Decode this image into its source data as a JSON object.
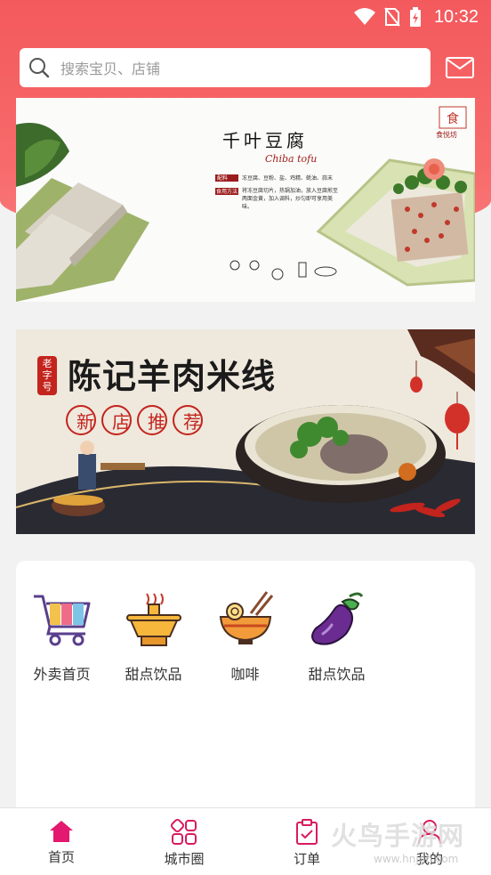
{
  "status_bar": {
    "time": "10:32"
  },
  "search": {
    "placeholder": "搜索宝贝、店铺"
  },
  "banner1": {
    "title": "千叶豆腐",
    "subtitle": "Chiba tofu",
    "tag1": "配料",
    "desc1": "冻豆腐、豆粉、盐、鸡精、蚝油、蒜末",
    "tag2": "食用方法",
    "desc2": "将冻豆腐切片，热锅加油，放入豆腐煎至两面金黄，加入调料，炒匀即可享用美味。",
    "brand": "食悦坊"
  },
  "banner2": {
    "badge": "老字号",
    "title": "陈记羊肉米线",
    "chars": [
      "新",
      "店",
      "推",
      "荐"
    ]
  },
  "categories": [
    {
      "label": "外卖首页",
      "icon": "shopping-cart-icon"
    },
    {
      "label": "甜点饮品",
      "icon": "hotpot-icon"
    },
    {
      "label": "咖啡",
      "icon": "noodle-bowl-icon"
    },
    {
      "label": "甜点饮品",
      "icon": "eggplant-icon"
    }
  ],
  "tabs": [
    {
      "label": "首页",
      "icon": "home-icon",
      "active": true
    },
    {
      "label": "城市圈",
      "icon": "grid-icon"
    },
    {
      "label": "订单",
      "icon": "order-icon"
    },
    {
      "label": "我的",
      "icon": "user-icon"
    }
  ],
  "watermark": {
    "main": "火鸟手游网",
    "sub": "www.hnjgh.com"
  },
  "colors": {
    "accent": "#f35a5d",
    "tab_active": "#e2196e",
    "tab_icon": "#d81b60"
  }
}
